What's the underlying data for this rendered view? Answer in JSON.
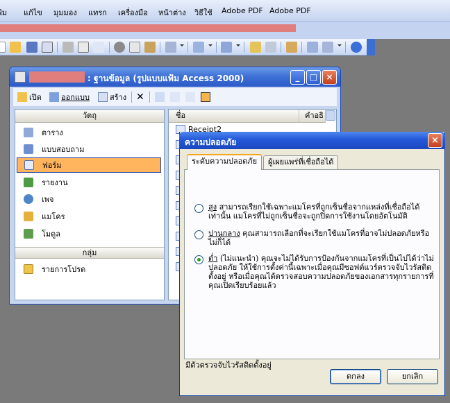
{
  "menubar": {
    "items": [
      "แฟ้ม",
      "แก้ไข",
      "มุมมอง",
      "แทรก",
      "เครื่องมือ",
      "หน้าต่าง",
      "วิธีใช้",
      "Adobe PDF",
      "Adobe PDF"
    ]
  },
  "db_window": {
    "title": ": ฐานข้อมูล (รูปแบบแฟ้ม Access 2000)",
    "buttons": {
      "minimize": "_",
      "maximize": "□",
      "close": "×"
    },
    "toolbar": {
      "open": "เปิด",
      "design": "ออกแบบ",
      "create": "สร้าง"
    },
    "objects_header": "วัตถุ",
    "objects": [
      "ตาราง",
      "แบบสอบถาม",
      "ฟอร์ม",
      "รายงาน",
      "เพจ",
      "แมโคร",
      "โมดูล"
    ],
    "selected_object": "ฟอร์ม",
    "groups_header": "กลุ่ม",
    "groups": [
      "รายการโปรด"
    ],
    "list": {
      "col_name": "ชื่อ",
      "col_desc": "คำอธิ",
      "first_item": "Receipt2"
    }
  },
  "dialog": {
    "title": "ความปลอดภัย",
    "close": "×",
    "tabs": [
      "ระดับความปลอดภัย",
      "ผู้เผยแพร่ที่เชื่อถือได้"
    ],
    "active_tab": "ระดับความปลอดภัย",
    "options": [
      {
        "key": "สูง",
        "text": " สามารถเรียกใช้เฉพาะแมโครที่ถูกเซ็นชื่อจากแหล่งที่เชื่อถือได้เท่านั้น แมโครที่ไม่ถูกเซ็นชื่อจะถูกปิดการใช้งานโดยอัตโนมัติ",
        "checked": false
      },
      {
        "key": "ปานกลาง",
        "text": " คุณสามารถเลือกที่จะเรียกใช้แมโครที่อาจไม่ปลอดภัยหรือ ไม่ก็ได้",
        "checked": false
      },
      {
        "key": "ต่ำ",
        "text": " (ไม่แนะนำ) คุณจะไม่ได้รับการป้องกันจากแมโครที่เป็นไปได้ว่าไม่ปลอดภัย ให้ใช้การตั้งค่านี้เฉพาะเมื่อคุณมีซอฟต์แวร์ตรวจจับไวรัสติดตั้งอยู่ หรือเมื่อคุณได้ตรวจสอบความปลอดภัยของเอกสารทุกรายการที่คุณเปิดเรียบร้อยแล้ว",
        "checked": true
      }
    ],
    "status": "มีตัวตรวจจับไวรัสติดตั้งอยู่",
    "ok": "ตกลง",
    "cancel": "ยกเลิก"
  },
  "colors": {
    "title_blue": "#2358d8",
    "selected_orange": "#ffb45d",
    "redacted": "#e07d7d",
    "dialog_face": "#ece9d8"
  },
  "icons": [
    "open-folder-icon",
    "save-icon",
    "print-icon",
    "spellcheck-icon",
    "cut-icon",
    "copy-icon",
    "paste-icon",
    "undo-icon",
    "help-icon",
    "delete-icon",
    "table-icon",
    "query-icon",
    "form-icon",
    "report-icon",
    "page-icon",
    "macro-icon",
    "module-icon",
    "favorites-icon"
  ]
}
